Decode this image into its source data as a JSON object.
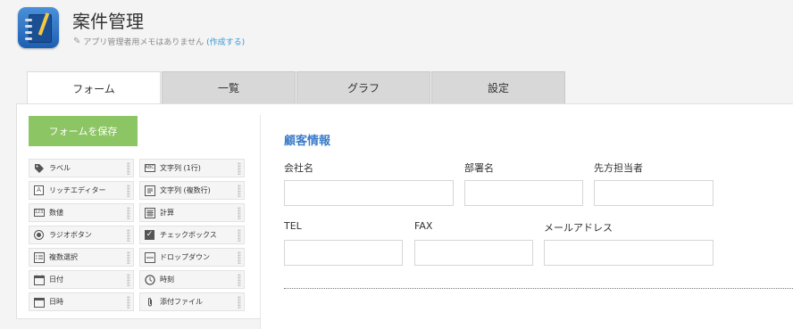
{
  "header": {
    "title": "案件管理",
    "memo_text": "アプリ管理者用メモはありません",
    "memo_link": "(作成する)"
  },
  "tabs": [
    {
      "label": "フォーム"
    },
    {
      "label": "一覧"
    },
    {
      "label": "グラフ"
    },
    {
      "label": "設定"
    }
  ],
  "toolbar": {
    "save_label": "フォームを保存"
  },
  "palette": [
    {
      "label": "ラベル",
      "icon": "tag-icon"
    },
    {
      "label": "文字列 (1行)",
      "icon": "text-single-icon"
    },
    {
      "label": "リッチエディター",
      "icon": "rich-editor-icon"
    },
    {
      "label": "文字列 (複数行)",
      "icon": "text-multi-icon"
    },
    {
      "label": "数値",
      "icon": "number-icon"
    },
    {
      "label": "計算",
      "icon": "calculator-icon"
    },
    {
      "label": "ラジオボタン",
      "icon": "radio-icon"
    },
    {
      "label": "チェックボックス",
      "icon": "checkbox-icon"
    },
    {
      "label": "複数選択",
      "icon": "multi-select-icon"
    },
    {
      "label": "ドロップダウン",
      "icon": "dropdown-icon"
    },
    {
      "label": "日付",
      "icon": "calendar-icon"
    },
    {
      "label": "時刻",
      "icon": "clock-icon"
    },
    {
      "label": "日時",
      "icon": "datetime-icon"
    },
    {
      "label": "添付ファイル",
      "icon": "paperclip-icon"
    }
  ],
  "form": {
    "section_title": "顧客情報",
    "fields": [
      {
        "label": "会社名"
      },
      {
        "label": "部署名"
      },
      {
        "label": "先方担当者"
      },
      {
        "label": "TEL"
      },
      {
        "label": "FAX"
      },
      {
        "label": "メールアドレス"
      }
    ]
  },
  "colors": {
    "save_button": "#8cc563",
    "section_title": "#3a7bc8",
    "link": "#3498db"
  }
}
